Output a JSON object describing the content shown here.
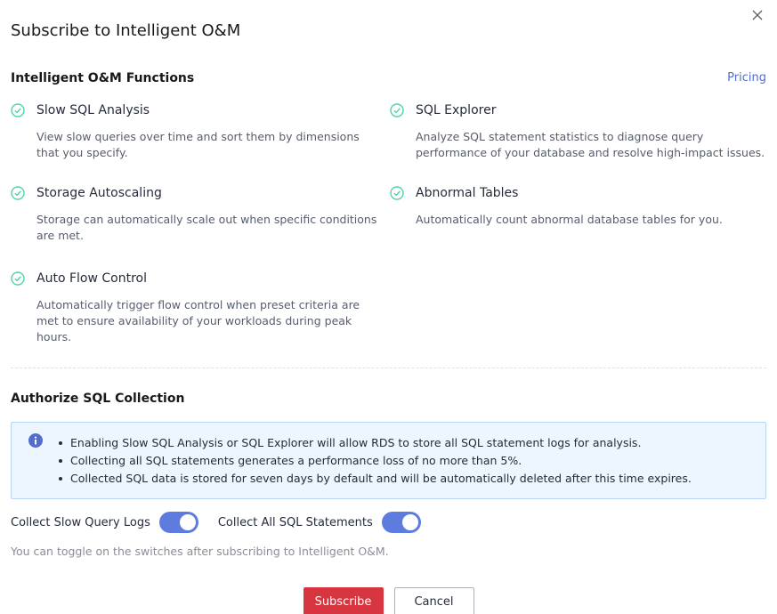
{
  "dialog": {
    "title": "Subscribe to Intelligent O&M"
  },
  "functions": {
    "heading": "Intelligent O&M Functions",
    "pricing_link": "Pricing",
    "items": [
      {
        "name": "Slow SQL Analysis",
        "desc": "View slow queries over time and sort them by dimensions that you specify."
      },
      {
        "name": "SQL Explorer",
        "desc": "Analyze SQL statement statistics to diagnose query performance of your database and resolve high-impact issues."
      },
      {
        "name": "Storage Autoscaling",
        "desc": "Storage can automatically scale out when specific conditions are met."
      },
      {
        "name": "Abnormal Tables",
        "desc": "Automatically count abnormal database tables for you."
      },
      {
        "name": "Auto Flow Control",
        "desc": "Automatically trigger flow control when preset criteria are met to ensure availability of your workloads during peak hours."
      }
    ]
  },
  "authorize": {
    "heading": "Authorize SQL Collection",
    "notices": [
      "Enabling Slow SQL Analysis or SQL Explorer will allow RDS to store all SQL statement logs for analysis.",
      "Collecting all SQL statements generates a performance loss of no more than 5%.",
      "Collected SQL data is stored for seven days by default and will be automatically deleted after this time expires."
    ],
    "toggles": [
      {
        "label": "Collect Slow Query Logs",
        "on": true
      },
      {
        "label": "Collect All SQL Statements",
        "on": true
      }
    ],
    "hint": "You can toggle on the switches after subscribing to Intelligent O&M."
  },
  "footer": {
    "subscribe_label": "Subscribe",
    "cancel_label": "Cancel"
  },
  "colors": {
    "accent": "#5e7ce0",
    "primary_button": "#d7353f",
    "link": "#526ecc",
    "check": "#50d4ab",
    "info": "#526ecc"
  },
  "icons": {
    "close": "close-icon",
    "check": "check-circle-icon",
    "info": "info-icon"
  }
}
